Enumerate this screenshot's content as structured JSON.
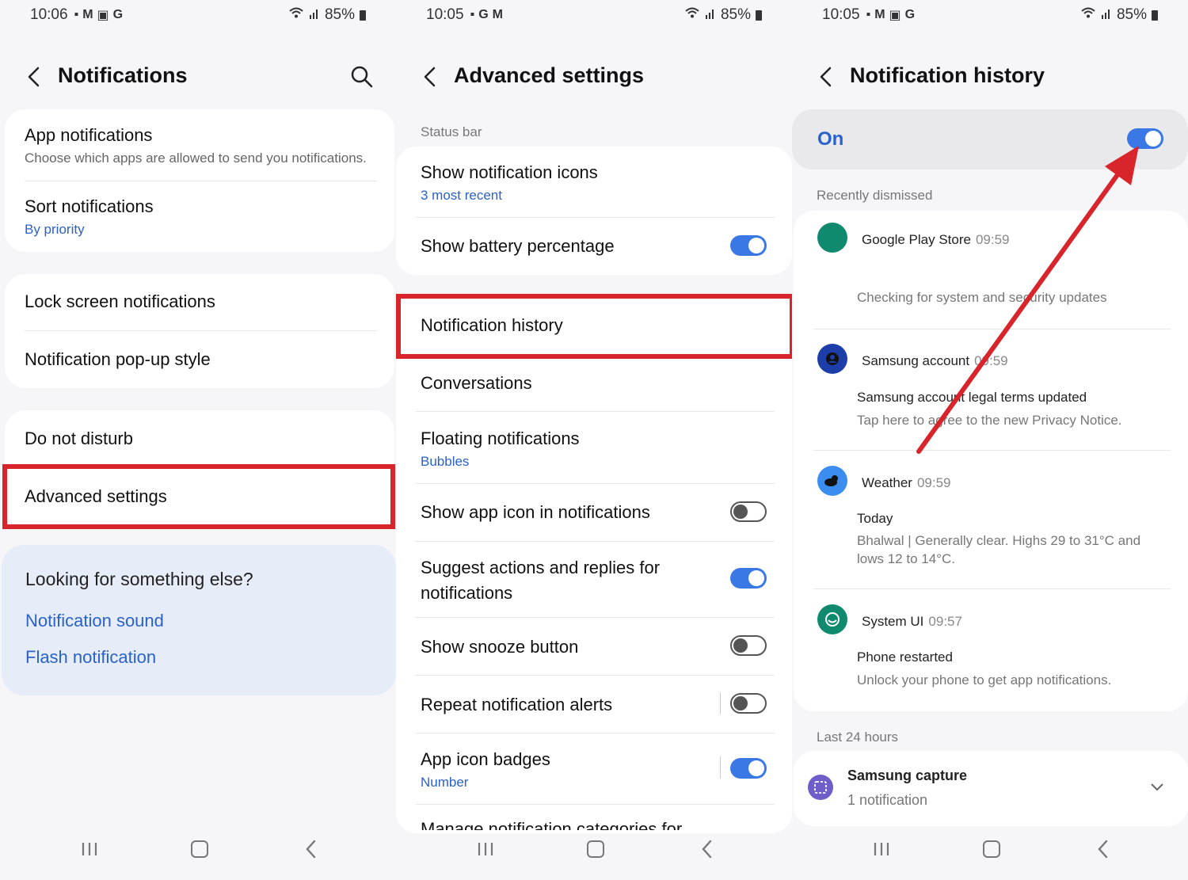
{
  "status_bars": [
    {
      "time": "10:06",
      "icons": [
        "M",
        "G"
      ],
      "battery": "85%"
    },
    {
      "time": "10:05",
      "icons": [
        "G",
        "M"
      ],
      "battery": "85%"
    },
    {
      "time": "10:05",
      "icons": [
        "M",
        "G"
      ],
      "battery": "85%"
    }
  ],
  "panel1": {
    "title": "Notifications",
    "items": [
      {
        "label": "App notifications",
        "sub": "Choose which apps are allowed to send you notifications."
      },
      {
        "label": "Sort notifications",
        "sub": "By priority"
      },
      {
        "label": "Lock screen notifications"
      },
      {
        "label": "Notification pop-up style"
      },
      {
        "label": "Do not disturb"
      },
      {
        "label": "Advanced settings"
      }
    ],
    "looking": {
      "heading": "Looking for something else?",
      "links": [
        "Notification sound",
        "Flash notification"
      ]
    }
  },
  "panel2": {
    "title": "Advanced settings",
    "section": "Status bar",
    "items": [
      {
        "label": "Show notification icons",
        "sub": "3 most recent"
      },
      {
        "label": "Show battery percentage",
        "toggle": true
      },
      {
        "label": "Notification history"
      },
      {
        "label": "Conversations"
      },
      {
        "label": "Floating notifications",
        "sub": "Bubbles"
      },
      {
        "label": "Show app icon in notifications",
        "toggle": false
      },
      {
        "label": "Suggest actions and replies for",
        "label2": "notifications",
        "toggle": true
      },
      {
        "label": "Show snooze button",
        "toggle": false
      },
      {
        "label": "Repeat notification alerts",
        "toggle": false
      },
      {
        "label": "App icon badges",
        "sub": "Number",
        "toggle": true
      },
      {
        "label": "Manage notification categories for"
      }
    ]
  },
  "panel3": {
    "title": "Notification history",
    "on_label": "On",
    "recently_dismissed": "Recently dismissed",
    "notifications": [
      {
        "app": "Google Play Store",
        "time": "09:59",
        "line1": "Checking for system and security updates",
        "color": "#0f8a6e"
      },
      {
        "app": "Samsung account",
        "time": "09:59",
        "line1": "Samsung account legal terms updated",
        "line2": "Tap here to agree to the new Privacy Notice.",
        "color": "#1d3ea8"
      },
      {
        "app": "Weather",
        "time": "09:59",
        "line1": "Today",
        "line2": "Bhalwal | Generally clear. Highs 29 to 31°C and",
        "line3": "lows 12 to 14°C.",
        "color": "#3b8ef0"
      },
      {
        "app": "System UI",
        "time": "09:57",
        "line1": "Phone restarted",
        "line2": "Unlock your phone to get app notifications.",
        "color": "#0f8a6e"
      }
    ],
    "last24": "Last 24 hours",
    "capture": {
      "app": "Samsung capture",
      "count": "1 notification"
    }
  },
  "colors": {
    "accent": "#3a78e6",
    "highlight": "#d8242b",
    "link": "#2a62c9"
  }
}
